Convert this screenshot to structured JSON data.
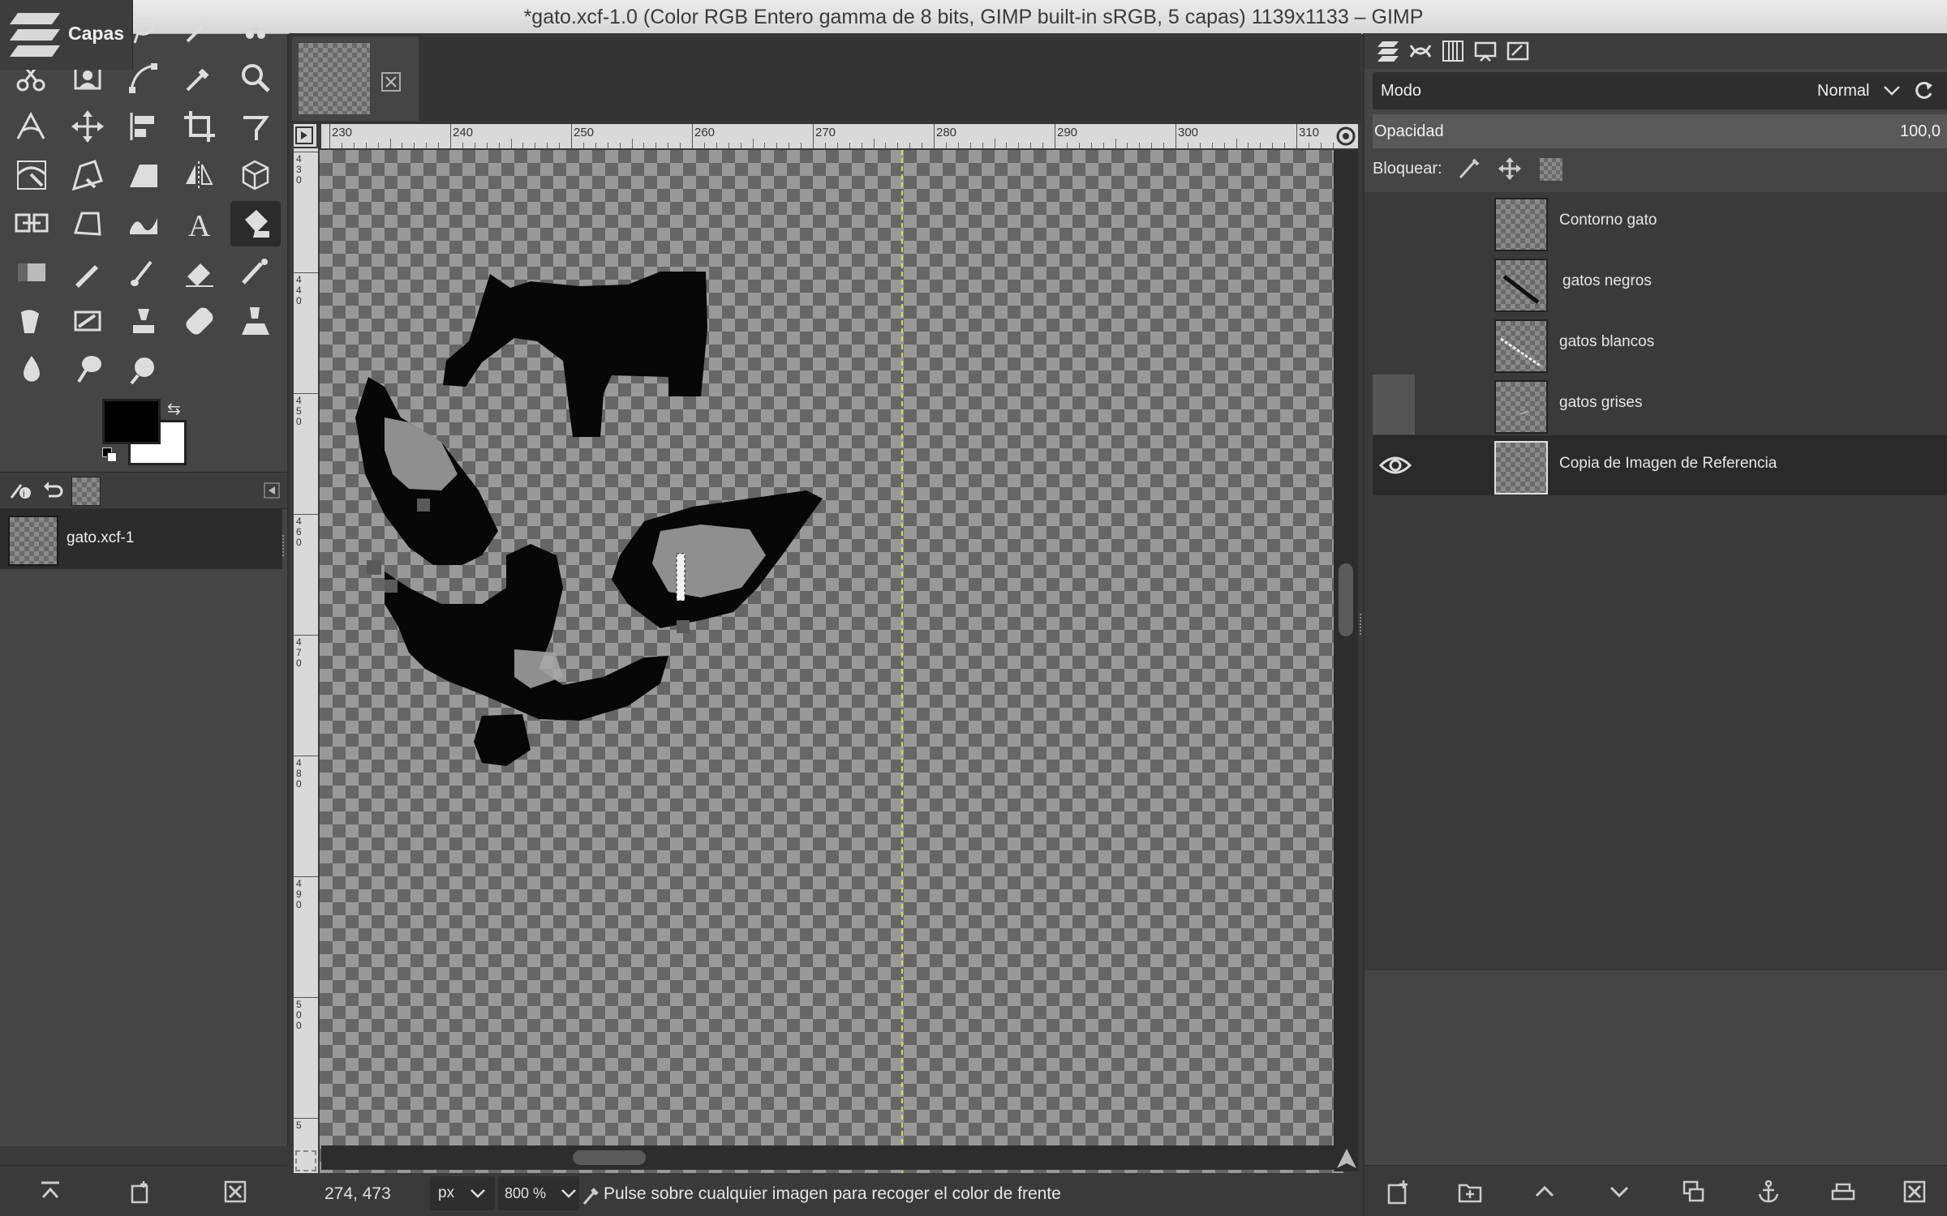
{
  "window": {
    "title": "*gato.xcf-1.0 (Color RGB Entero gamma de 8 bits, GIMP built-in sRGB, 5 capas) 1139x1133 – GIMP",
    "dock_tab_label": "Capas"
  },
  "toolbox": {
    "tools": [
      "rect-select",
      "ellipse-select",
      "free-select",
      "fuzzy-select",
      "by-color-select",
      "scissors-select",
      "foreground-select",
      "paths",
      "color-picker",
      "zoom",
      "measure",
      "move",
      "align",
      "crop",
      "unified-transform",
      "warp-transform",
      "handle-transform",
      "perspective",
      "flip",
      "3d-transform",
      "cage-transform",
      "text-path",
      "smudge-wave",
      "text",
      "bucket-fill",
      "gradient",
      "pencil",
      "paintbrush",
      "eraser",
      "airbrush",
      "ink",
      "mypaint-brush",
      "clone",
      "heal",
      "perspective-clone",
      "blur",
      "smudge",
      "dodge-burn"
    ],
    "active_tool": "bucket-fill",
    "fg_color": "#000000",
    "bg_color": "#ffffff"
  },
  "images_panel": {
    "items": [
      {
        "name": "gato.xcf-1"
      }
    ]
  },
  "rulers": {
    "top_labels": [
      "230",
      "240",
      "250",
      "260",
      "270",
      "280",
      "290",
      "300",
      "310"
    ],
    "left_labels": [
      "430",
      "440",
      "450",
      "460",
      "470",
      "480",
      "490",
      "500",
      "5"
    ]
  },
  "statusbar": {
    "coords": "274, 473",
    "unit": "px",
    "zoom": "800 %",
    "message": "Pulse sobre cualquier imagen para recoger el color de frente"
  },
  "layers_panel": {
    "mode_label": "Modo",
    "mode_value": "Normal",
    "opacity_label": "Opacidad",
    "opacity_value": "100,0",
    "lock_label": "Bloquear:",
    "layers": [
      {
        "name": "Contorno gato",
        "visible": false
      },
      {
        "name": "gatos negros",
        "visible": false
      },
      {
        "name": "gatos blancos",
        "visible": false
      },
      {
        "name": "gatos grises",
        "visible": false
      },
      {
        "name": "Copia de Imagen de Referencia",
        "visible": true,
        "selected": true
      }
    ]
  }
}
